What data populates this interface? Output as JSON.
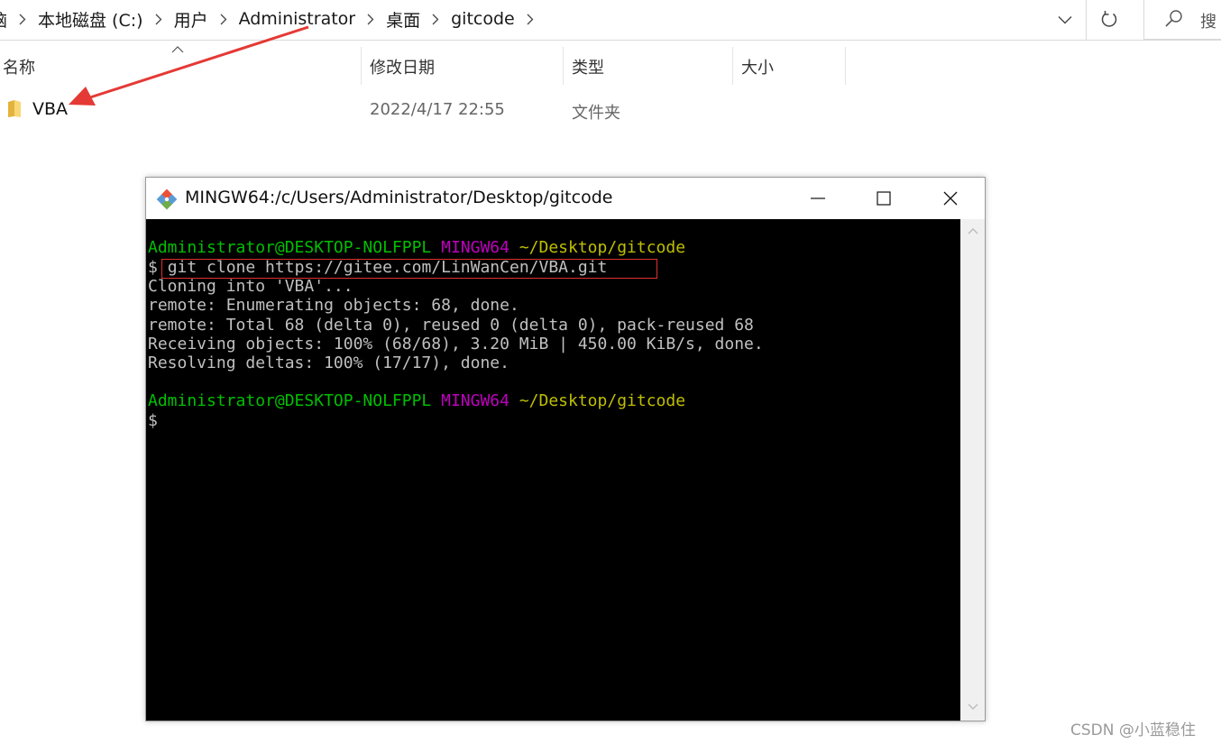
{
  "explorer": {
    "breadcrumbs": [
      "脑",
      "本地磁盘 (C:)",
      "用户",
      "Administrator",
      "桌面",
      "gitcode"
    ],
    "search_placeholder": "搜",
    "columns": {
      "name": "名称",
      "modified": "修改日期",
      "type": "类型",
      "size": "大小"
    },
    "files": [
      {
        "name": "VBA",
        "modified": "2022/4/17 22:55",
        "type": "文件夹",
        "size": ""
      }
    ]
  },
  "terminal_window": {
    "title": "MINGW64:/c/Users/Administrator/Desktop/gitcode",
    "prompt": {
      "user_host": "Administrator@DESKTOP-NOLFPPL",
      "system": "MINGW64",
      "path": "~/Desktop/gitcode",
      "symbol": "$"
    },
    "command": "git clone https://gitee.com/LinWanCen/VBA.git",
    "output": [
      "Cloning into 'VBA'...",
      "remote: Enumerating objects: 68, done.",
      "remote: Total 68 (delta 0), reused 0 (delta 0), pack-reused 68",
      "Receiving objects: 100% (68/68), 3.20 MiB | 450.00 KiB/s, done.",
      "Resolving deltas: 100% (17/17), done."
    ]
  },
  "watermark": "CSDN @小蓝稳住",
  "colors": {
    "prompt_user": "#00bf00",
    "prompt_system": "#bf00bf",
    "prompt_path": "#bfbf00",
    "terminal_text": "#c0c0c0",
    "terminal_bg": "#000000",
    "highlight_box": "#e03030",
    "annotation_arrow": "#e53935"
  },
  "icons": {
    "breadcrumb_separator": "chevron-right-icon",
    "address_dropdown": "chevron-down-icon",
    "refresh": "refresh-icon",
    "search": "search-icon",
    "folder": "folder-icon",
    "app": "git-icon"
  }
}
